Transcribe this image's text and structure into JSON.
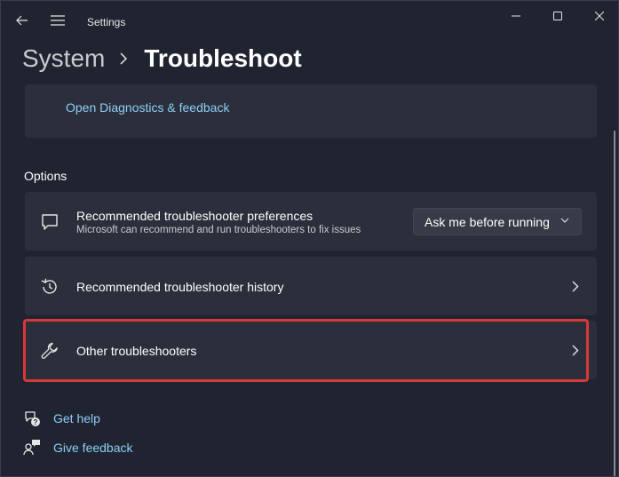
{
  "window": {
    "app_title": "Settings"
  },
  "breadcrumb": {
    "parent": "System",
    "current": "Troubleshoot"
  },
  "diagnostics": {
    "link_label": "Open Diagnostics & feedback"
  },
  "options": {
    "section_label": "Options",
    "preferences": {
      "title": "Recommended troubleshooter preferences",
      "subtitle": "Microsoft can recommend and run troubleshooters to fix issues",
      "dropdown_value": "Ask me before running",
      "icon": "chat-bubble-icon"
    },
    "history": {
      "title": "Recommended troubleshooter history",
      "icon": "history-icon"
    },
    "other": {
      "title": "Other troubleshooters",
      "icon": "wrench-icon"
    }
  },
  "help": {
    "get_help": "Get help",
    "give_feedback": "Give feedback"
  },
  "colors": {
    "background": "#202431",
    "card": "#2b2f3b",
    "link": "#8ecdf4",
    "highlight": "#d9383a"
  }
}
